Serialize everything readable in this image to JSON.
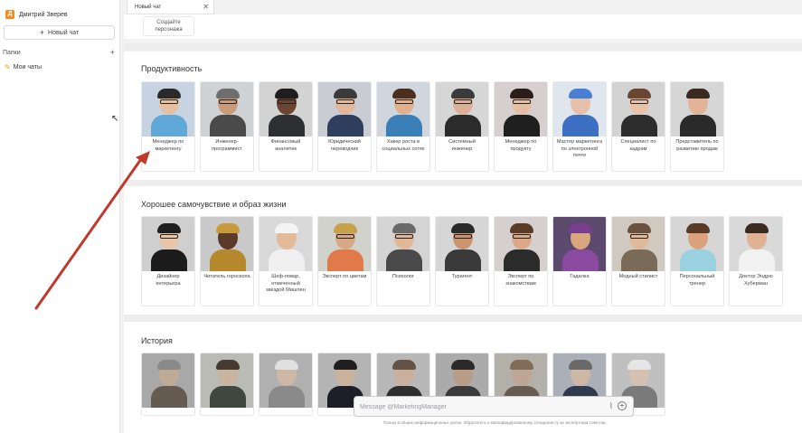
{
  "sidebar": {
    "avatar_letter": "Д",
    "user_name": "Дмитрий Зверев",
    "new_chat": "Новый чат",
    "folders_label": "Папки",
    "my_chats": "Мои чаты"
  },
  "tabs": [
    {
      "label": "Новый чат"
    }
  ],
  "create_character": "Создайте персонажа",
  "sections": [
    {
      "title": "Продуктивность",
      "cards": [
        {
          "label": "Менеджер по маркетингу",
          "bg": "#c7d3e0",
          "skin": "#e6bfa2",
          "hair": "#2a2a2a",
          "shirt": "#5fa8d8",
          "glasses": true
        },
        {
          "label": "Инженер-программист",
          "bg": "#cfd2d4",
          "skin": "#c89a7a",
          "hair": "#6e6e6e",
          "shirt": "#4a4a4a",
          "glasses": true
        },
        {
          "label": "Финансовый аналитик",
          "bg": "#d3d3d3",
          "skin": "#6b4530",
          "hair": "#1e1e1e",
          "shirt": "#2d2f33",
          "glasses": true
        },
        {
          "label": "Юридический переводчик",
          "bg": "#c9ccd3",
          "skin": "#e1b899",
          "hair": "#3a3a3a",
          "shirt": "#2f3e5c",
          "glasses": true
        },
        {
          "label": "Хакер роста в социальных сетях",
          "bg": "#cfd6de",
          "skin": "#e0b08f",
          "hair": "#4a2f20",
          "shirt": "#3b7fb8",
          "glasses": true
        },
        {
          "label": "Системный инженер",
          "bg": "#d6d6d6",
          "skin": "#dcb096",
          "hair": "#3b3b3b",
          "shirt": "#2b2b2b",
          "glasses": true
        },
        {
          "label": "Менеджер по продукту",
          "bg": "#d7cfcf",
          "skin": "#e5bfa5",
          "hair": "#2b1e1a",
          "shirt": "#1f1f1f",
          "glasses": true
        },
        {
          "label": "Мастер маркетинга по электронной почте",
          "bg": "#dfe6ee",
          "skin": "#e6c0a8",
          "hair": "#4a7fd4",
          "shirt": "#3d6fc2",
          "glasses": false
        },
        {
          "label": "Специалист по кадрам",
          "bg": "#d3d3d3",
          "skin": "#e8c3aa",
          "hair": "#6a4632",
          "shirt": "#2d2d2d",
          "glasses": true
        },
        {
          "label": "Представитель по развитию продаж",
          "bg": "#d6d6d6",
          "skin": "#e2b497",
          "hair": "#3a2a20",
          "shirt": "#2a2a2a",
          "glasses": false
        }
      ]
    },
    {
      "title": "Хорошее самочувствие и образ жизни",
      "cards": [
        {
          "label": "Дизайнер интерьера",
          "bg": "#cfcfcf",
          "skin": "#e8c4a8",
          "hair": "#1e1e1e",
          "shirt": "#1c1c1c",
          "glasses": true
        },
        {
          "label": "Читатель гороскопа",
          "bg": "#c9c9c9",
          "skin": "#5a3a28",
          "hair": "#c89a3a",
          "shirt": "#b5892c",
          "glasses": false
        },
        {
          "label": "Шеф-повар, отмеченный звездой Мишлен",
          "bg": "#d9d9d9",
          "skin": "#e3b99a",
          "hair": "#f4f4f4",
          "shirt": "#f0f0f0",
          "glasses": false
        },
        {
          "label": "Эксперт по цветам",
          "bg": "#d2d2cc",
          "skin": "#d6a884",
          "hair": "#c8a04a",
          "shirt": "#e07a4a",
          "glasses": true
        },
        {
          "label": "Психолог",
          "bg": "#d4d4d4",
          "skin": "#e0b899",
          "hair": "#6a6a6a",
          "shirt": "#4a4a4a",
          "glasses": true
        },
        {
          "label": "Турагент",
          "bg": "#d6d6d6",
          "skin": "#c9946f",
          "hair": "#2a2a2a",
          "shirt": "#3a3a3a",
          "glasses": true
        },
        {
          "label": "Эксперт по знакомствам",
          "bg": "#d6cfcf",
          "skin": "#dba98a",
          "hair": "#5a3b28",
          "shirt": "#2b2b2b",
          "glasses": true
        },
        {
          "label": "Гадалка",
          "bg": "#5c4a6e",
          "skin": "#d9a67e",
          "hair": "#7a3e8e",
          "shirt": "#8a4aa0",
          "glasses": false
        },
        {
          "label": "Модный стилист",
          "bg": "#d0c9c0",
          "skin": "#e0b89a",
          "hair": "#6a5240",
          "shirt": "#7a6a58",
          "glasses": true
        },
        {
          "label": "Персональный тренер",
          "bg": "#d6d6d6",
          "skin": "#d9a27c",
          "hair": "#5a3a25",
          "shirt": "#9ad1e0",
          "glasses": false
        },
        {
          "label": "Доктор Эндрю Хуберман",
          "bg": "#d9d9d9",
          "skin": "#e0b193",
          "hair": "#3a2a20",
          "shirt": "#f2f2f2",
          "glasses": false
        }
      ]
    },
    {
      "title": "История",
      "cards": [
        {
          "label": "",
          "bg": "#a8a8a8",
          "skin": "#c9a88a",
          "hair": "#8a8a8a",
          "shirt": "#6a5a4a",
          "glasses": false
        },
        {
          "label": "",
          "bg": "#b8bcb0",
          "skin": "#d2b296",
          "hair": "#4a3a2a",
          "shirt": "#3a4a3a",
          "glasses": false
        },
        {
          "label": "",
          "bg": "#b0b0b0",
          "skin": "#d8b59a",
          "hair": "#e0e0e0",
          "shirt": "#8a8a8a",
          "glasses": false
        },
        {
          "label": "",
          "bg": "#b4b4b4",
          "skin": "#d6b090",
          "hair": "#1e1e1e",
          "shirt": "#1e1e2e",
          "glasses": false
        },
        {
          "label": "",
          "bg": "#b8b8b8",
          "skin": "#d4ad90",
          "hair": "#6a5040",
          "shirt": "#2e2e2e",
          "glasses": false
        },
        {
          "label": "",
          "bg": "#ababab",
          "skin": "#c69a78",
          "hair": "#2a2a2a",
          "shirt": "#3a3a3a",
          "glasses": false
        },
        {
          "label": "",
          "bg": "#b5afa6",
          "skin": "#c9a488",
          "hair": "#8a6a4a",
          "shirt": "#6e5a48",
          "glasses": false
        },
        {
          "label": "",
          "bg": "#a9b0bc",
          "skin": "#d8b59a",
          "hair": "#6a6a6a",
          "shirt": "#2a3a5a",
          "glasses": false
        },
        {
          "label": "",
          "bg": "#c0c0c0",
          "skin": "#dcc0a8",
          "hair": "#e6e6e6",
          "shirt": "#7a7a7a",
          "glasses": false
        }
      ]
    }
  ],
  "message": {
    "placeholder": "Message @MarketingManager"
  },
  "disclaimer": "Только в общих информационных целях. Обратитесь к квалифицированному специалисту за экспертным советом."
}
